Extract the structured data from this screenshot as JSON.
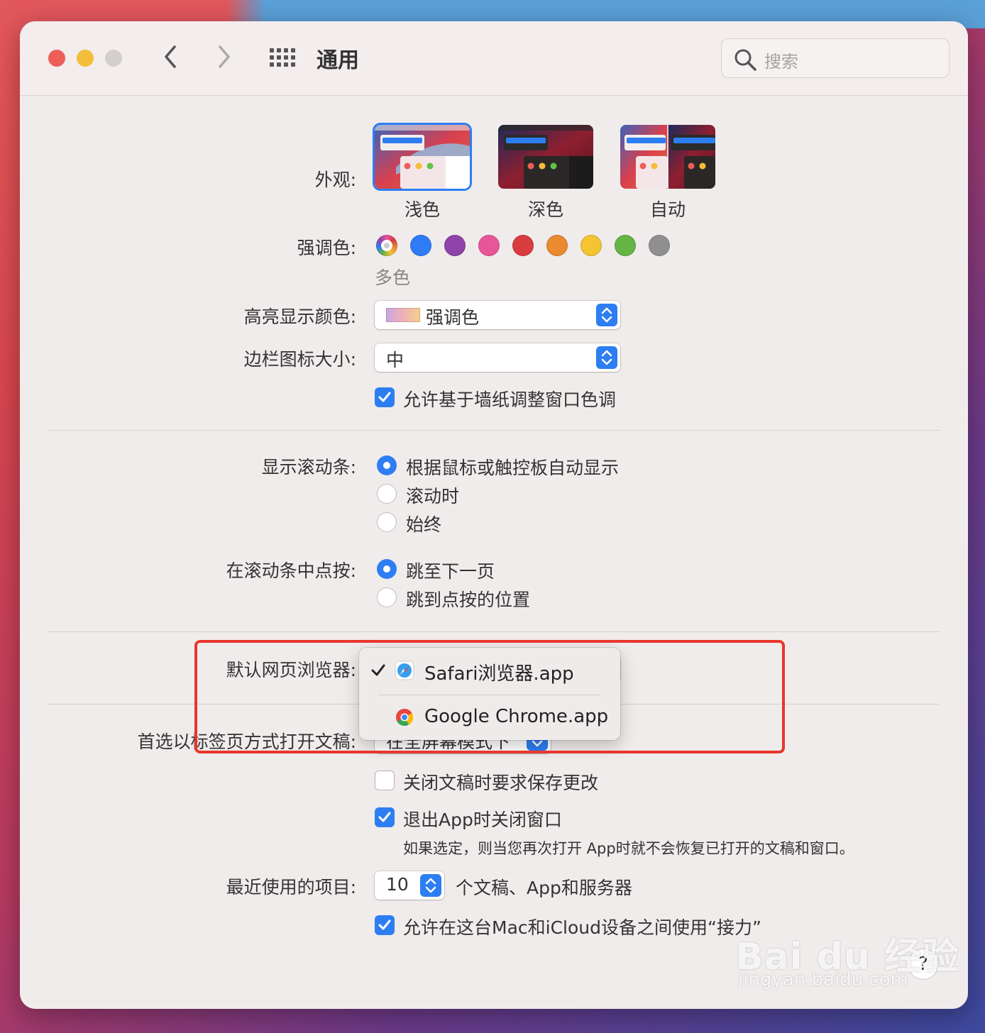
{
  "window": {
    "title": "通用"
  },
  "search": {
    "placeholder": "搜索"
  },
  "appearance": {
    "label": "外观:",
    "options": [
      {
        "label": "浅色",
        "selected": true
      },
      {
        "label": "深色",
        "selected": false
      },
      {
        "label": "自动",
        "selected": false
      }
    ]
  },
  "accent": {
    "label": "强调色:",
    "selected_name": "多色",
    "colors": [
      "multicolor",
      "#2f7cf6",
      "#8e44a8",
      "#e8569a",
      "#d93c3f",
      "#ec8a30",
      "#f4c433",
      "#64b545",
      "#8f8f8f"
    ]
  },
  "highlight": {
    "label": "高亮显示颜色:",
    "value": "强调色"
  },
  "sidebar_icon_size": {
    "label": "边栏图标大小:",
    "value": "中"
  },
  "wallpaper_tint": {
    "label": "允许基于墙纸调整窗口色调",
    "checked": true
  },
  "scrollbars": {
    "label": "显示滚动条:",
    "options": [
      {
        "label": "根据鼠标或触控板自动显示",
        "selected": true
      },
      {
        "label": "滚动时",
        "selected": false
      },
      {
        "label": "始终",
        "selected": false
      }
    ]
  },
  "scroll_click": {
    "label": "在滚动条中点按:",
    "options": [
      {
        "label": "跳至下一页",
        "selected": true
      },
      {
        "label": "跳到点按的位置",
        "selected": false
      }
    ]
  },
  "default_browser": {
    "label": "默认网页浏览器:",
    "menu": [
      {
        "label": "Safari浏览器.app",
        "checked": true,
        "icon": "safari-icon"
      },
      {
        "label": "Google Chrome.app",
        "checked": false,
        "icon": "chrome-icon"
      }
    ]
  },
  "prefer_tabs": {
    "label": "首选以标签页方式打开文稿:",
    "value": "在全屏幕模式下"
  },
  "ask_save": {
    "label": "关闭文稿时要求保存更改",
    "checked": false
  },
  "close_windows": {
    "label": "退出App时关闭窗口",
    "checked": true,
    "hint": "如果选定，则当您再次打开 App时就不会恢复已打开的文稿和窗口。"
  },
  "recent_items": {
    "label": "最近使用的项目:",
    "value": "10",
    "suffix": "个文稿、App和服务器"
  },
  "handoff": {
    "label": "允许在这台Mac和iCloud设备之间使用“接力”",
    "checked": true
  },
  "help": {
    "label": "?"
  },
  "watermark": {
    "brand": "Bai du 经验",
    "url": "jingyan.baidu.com"
  }
}
